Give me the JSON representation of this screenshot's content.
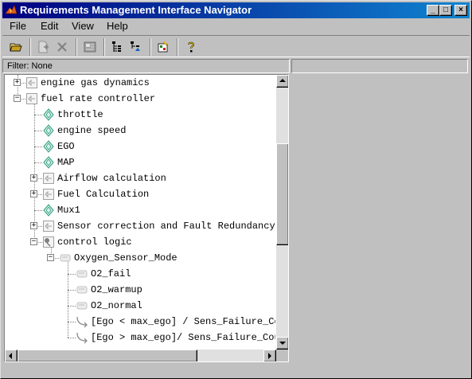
{
  "window": {
    "title": "Requirements Management Interface Navigator",
    "controls": {
      "minimize": "_",
      "maximize": "□",
      "close": "×"
    }
  },
  "menubar": {
    "items": [
      "File",
      "Edit",
      "View",
      "Help"
    ]
  },
  "toolbar": {
    "buttons": [
      "open-folder",
      "new-link",
      "delete",
      "properties",
      "expand-tree",
      "collapse-tree",
      "highlight",
      "help"
    ]
  },
  "filter": {
    "label": "Filter: None"
  },
  "tree": {
    "rows": [
      {
        "label": "engine  gas dynamics",
        "icon": "subsystem-icon",
        "expander": "+"
      },
      {
        "label": "fuel rate controller",
        "icon": "subsystem-icon",
        "expander": "−"
      },
      {
        "label": "throttle",
        "icon": "diamond-icon",
        "expander": ""
      },
      {
        "label": "engine speed",
        "icon": "diamond-icon",
        "expander": ""
      },
      {
        "label": "EGO",
        "icon": "diamond-icon",
        "expander": ""
      },
      {
        "label": "MAP",
        "icon": "diamond-icon",
        "expander": ""
      },
      {
        "label": "Airflow calculation",
        "icon": "subsystem-icon",
        "expander": "+"
      },
      {
        "label": "Fuel  Calculation",
        "icon": "subsystem-icon",
        "expander": "+"
      },
      {
        "label": "Mux1",
        "icon": "diamond-icon",
        "expander": ""
      },
      {
        "label": "Sensor correction and  Fault Redundancy",
        "icon": "subsystem-icon",
        "expander": "+"
      },
      {
        "label": "control logic",
        "icon": "stateflow-chart-icon",
        "expander": "−"
      },
      {
        "label": "Oxygen_Sensor_Mode",
        "icon": "state-icon",
        "expander": "−"
      },
      {
        "label": "O2_fail",
        "icon": "state-icon",
        "expander": ""
      },
      {
        "label": "O2_warmup",
        "icon": "state-icon",
        "expander": ""
      },
      {
        "label": "O2_normal",
        "icon": "state-icon",
        "expander": ""
      },
      {
        "label": "[Ego < max_ego] / Sens_Failure_Counter++",
        "icon": "transition-icon",
        "expander": ""
      },
      {
        "label": "[Ego > max_ego]/ Sens_Failure_Counter--",
        "icon": "transition-icon",
        "expander": ""
      }
    ]
  },
  "scrollbars": {
    "vertical_position": 0.38,
    "horizontal_position": 0.0
  },
  "colors": {
    "titlebar_start": "#000080",
    "titlebar_end": "#1084d0",
    "diamond": "#2e9a7a"
  }
}
